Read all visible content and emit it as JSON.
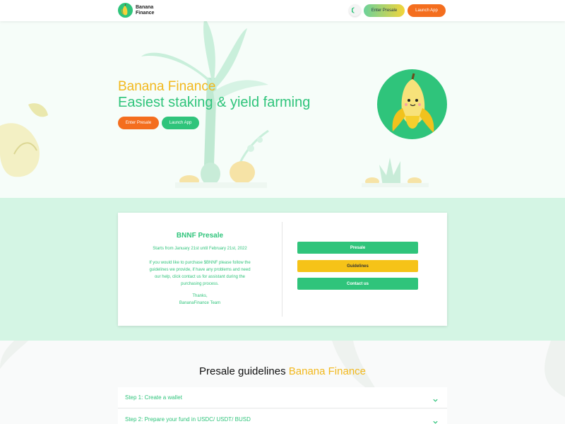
{
  "header": {
    "logo_line1": "Banana",
    "logo_line2": "Finance",
    "enter_presale": "Enter Presale",
    "launch_app": "Launch App",
    "theme_icon": "moon-icon"
  },
  "hero": {
    "title": "Banana Finance",
    "subtitle": "Easiest staking & yield farming",
    "enter_presale": "Enter Presale",
    "launch_app": "Launch App"
  },
  "presale_card": {
    "title": "BNNF Presale",
    "dates": "Starts from January 21st until February 21st, 2022",
    "body": "If you would like to purchase $BNNF please follow the guidelines we provide, if have any problems and need our help, click contact us for assistant during the purchasing process.",
    "thanks": "Thanks,",
    "team": "BananaFinance Team",
    "buttons": {
      "presale": "Presale",
      "guidelines": "Guidelines",
      "contact": "Contact us"
    }
  },
  "guidelines": {
    "heading": "Presale guidelines",
    "heading_accent": "Banana Finance",
    "steps": [
      {
        "label": "Step 1: Create a wallet"
      },
      {
        "label": "Step 2: Prepare your fund in USDC/ USDT/ BUSD"
      }
    ]
  },
  "colors": {
    "green": "#2fc47b",
    "yellow": "#f2b81d",
    "orange": "#f46e1e",
    "mint": "#d4f5e4"
  }
}
